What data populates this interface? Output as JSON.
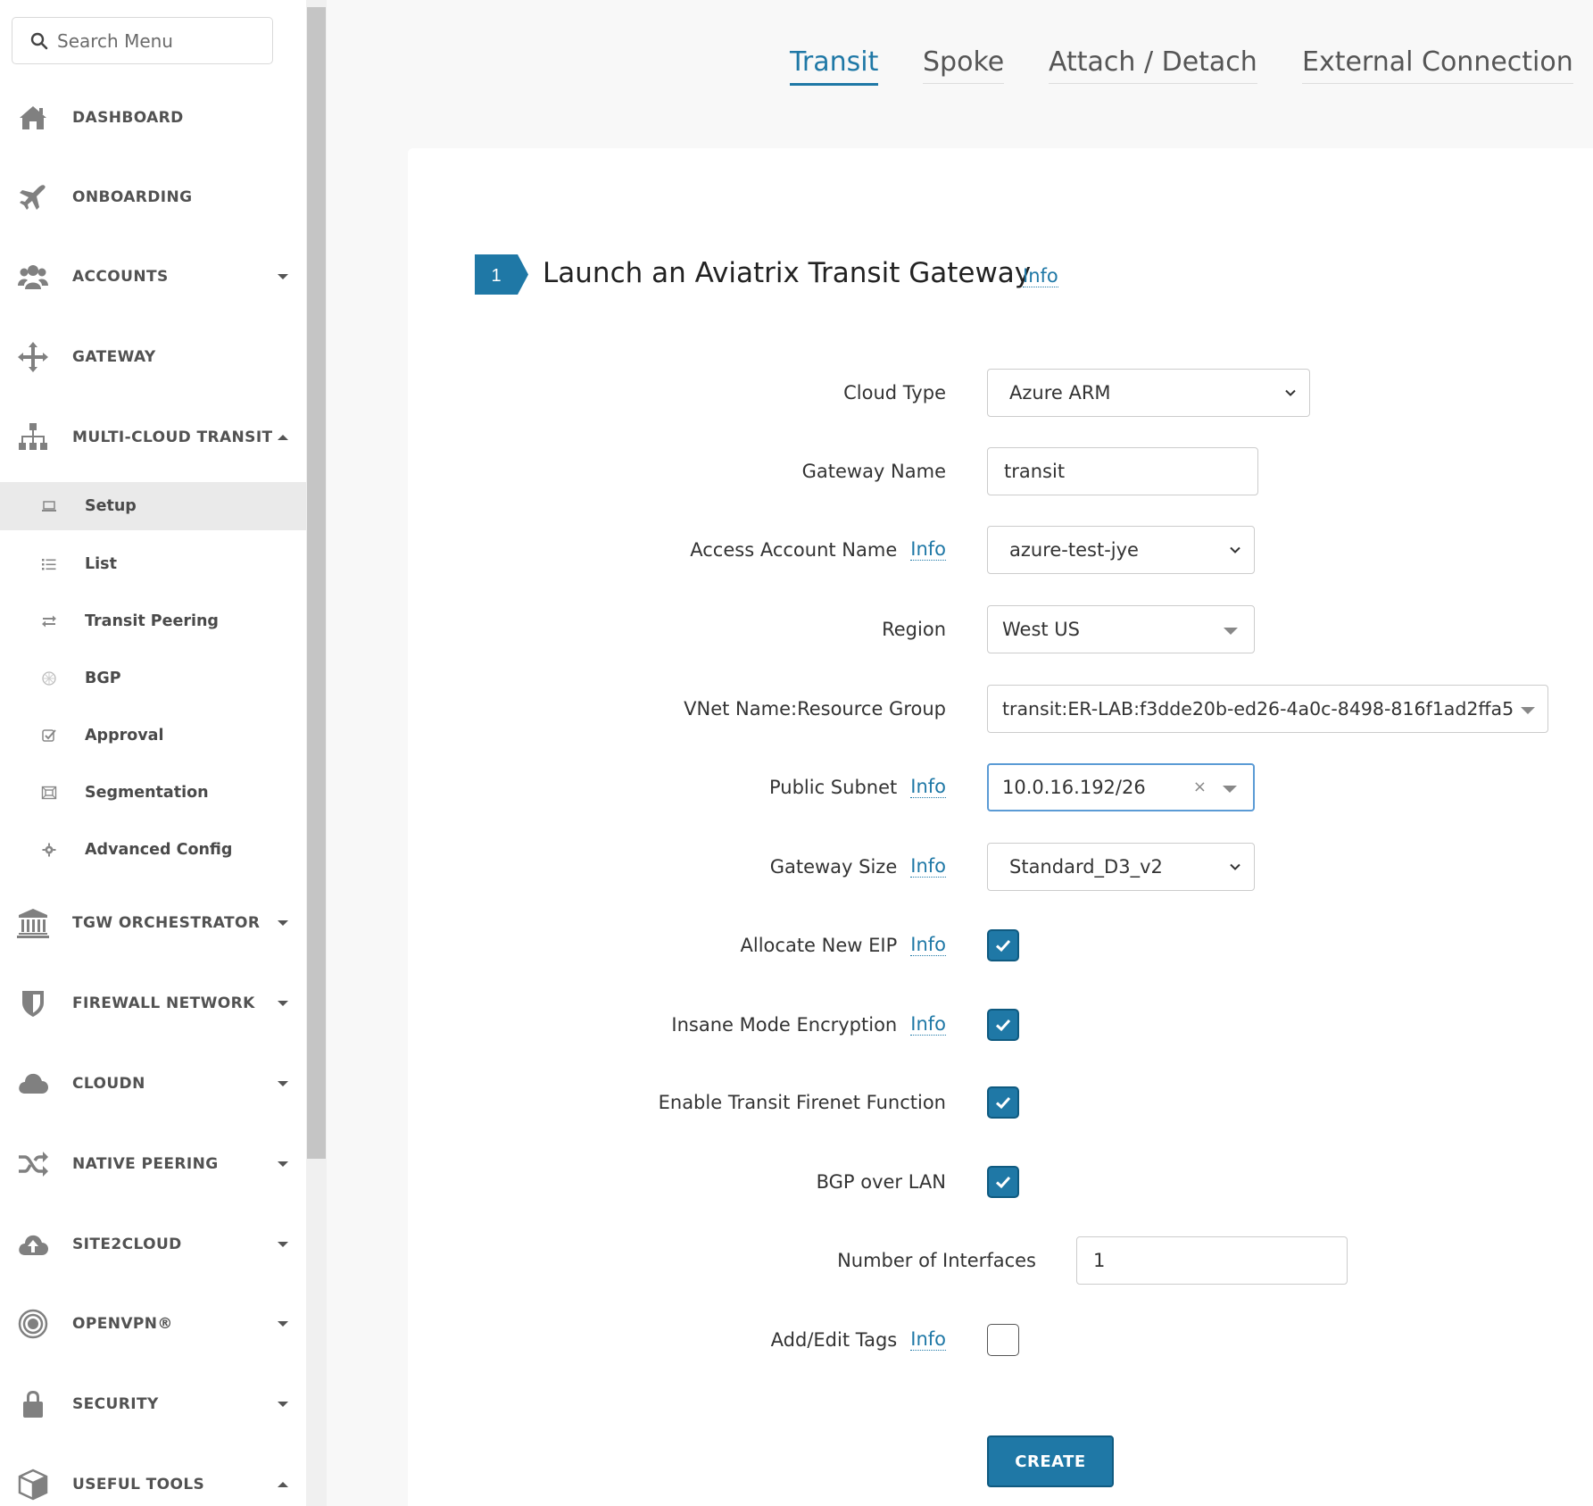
{
  "search": {
    "placeholder": "Search Menu"
  },
  "sidebar": {
    "items": [
      {
        "label": "DASHBOARD"
      },
      {
        "label": "ONBOARDING"
      },
      {
        "label": "ACCOUNTS"
      },
      {
        "label": "GATEWAY"
      },
      {
        "label": "MULTI-CLOUD TRANSIT"
      },
      {
        "label": "TGW ORCHESTRATOR"
      },
      {
        "label": "FIREWALL NETWORK"
      },
      {
        "label": "CLOUDN"
      },
      {
        "label": "NATIVE PEERING"
      },
      {
        "label": "SITE2CLOUD"
      },
      {
        "label": "OPENVPN®"
      },
      {
        "label": "SECURITY"
      },
      {
        "label": "USEFUL TOOLS"
      }
    ],
    "subitems": [
      {
        "label": "Setup"
      },
      {
        "label": "List"
      },
      {
        "label": "Transit Peering"
      },
      {
        "label": "BGP"
      },
      {
        "label": "Approval"
      },
      {
        "label": "Segmentation"
      },
      {
        "label": "Advanced Config"
      }
    ]
  },
  "tabs": [
    {
      "label": "Transit"
    },
    {
      "label": "Spoke"
    },
    {
      "label": "Attach / Detach"
    },
    {
      "label": "External Connection"
    }
  ],
  "step": {
    "number": "1",
    "title": "Launch an Aviatrix Transit Gateway",
    "info": "Info"
  },
  "form": {
    "cloud_type": {
      "label": "Cloud Type",
      "value": "Azure ARM"
    },
    "gateway_name": {
      "label": "Gateway Name",
      "value": "transit"
    },
    "access_account": {
      "label": "Access Account Name",
      "info": "Info",
      "value": "azure-test-jye"
    },
    "region": {
      "label": "Region",
      "value": "West US"
    },
    "vnet": {
      "label": "VNet Name:Resource Group",
      "value": "transit:ER-LAB:f3dde20b-ed26-4a0c-8498-816f1ad2ffa5"
    },
    "public_subnet": {
      "label": "Public Subnet",
      "info": "Info",
      "value": "10.0.16.192/26",
      "clear": "×"
    },
    "gateway_size": {
      "label": "Gateway Size",
      "info": "Info",
      "value": "Standard_D3_v2"
    },
    "allocate_eip": {
      "label": "Allocate New EIP",
      "info": "Info",
      "checked": true
    },
    "insane_mode": {
      "label": "Insane Mode Encryption",
      "info": "Info",
      "checked": true
    },
    "firenet": {
      "label": "Enable Transit Firenet Function",
      "checked": true
    },
    "bgp_lan": {
      "label": "BGP over LAN",
      "checked": true
    },
    "num_interfaces": {
      "label": "Number of Interfaces",
      "value": "1"
    },
    "tags": {
      "label": "Add/Edit Tags",
      "info": "Info",
      "checked": false
    },
    "create_label": "CREATE"
  },
  "colors": {
    "accent": "#1f78a6",
    "sidebar_text": "#525252",
    "active_sub_bg": "#eaeaea"
  }
}
